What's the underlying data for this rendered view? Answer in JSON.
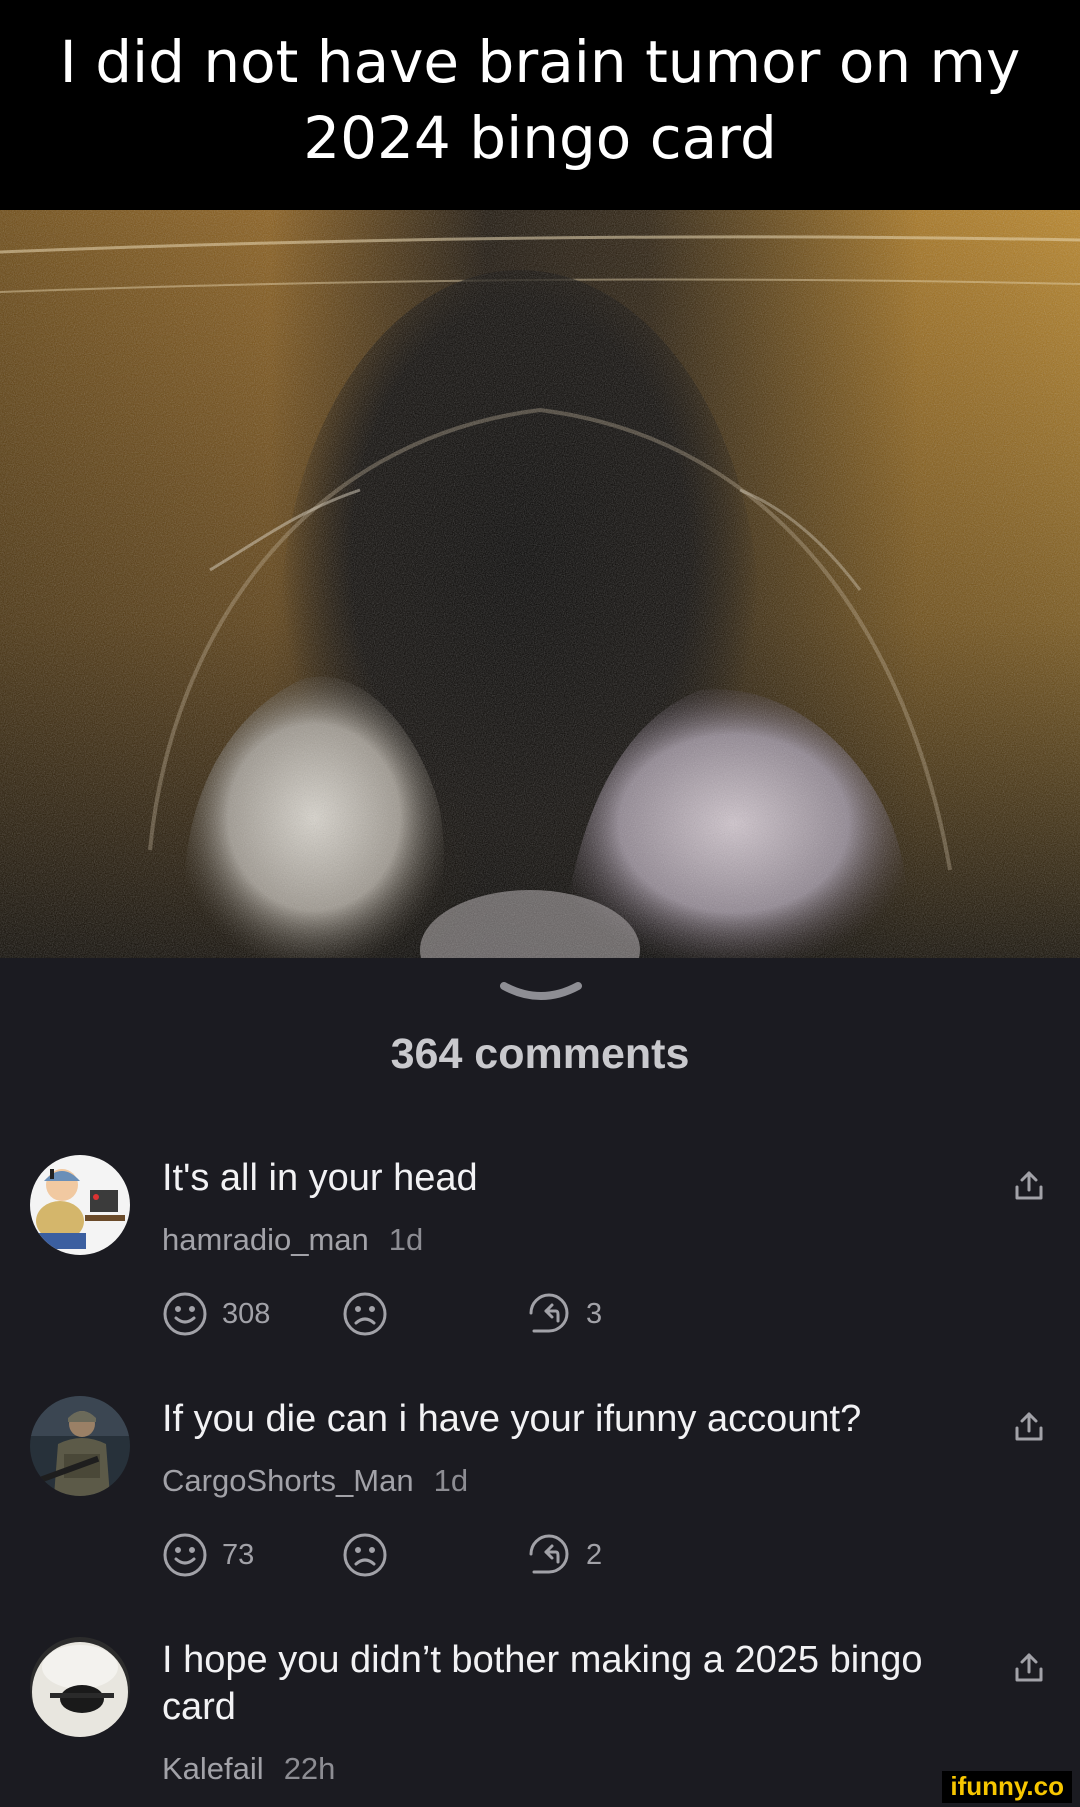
{
  "post": {
    "caption_lines": [
      "I did not have brain tumor on my",
      "2024 bingo card"
    ]
  },
  "comments_header": {
    "count_label": "364 comments"
  },
  "comments": [
    {
      "text": "It's all in your head",
      "user": "hamradio_man",
      "time": "1d",
      "smile_count": "308",
      "reply_count": "3"
    },
    {
      "text": "If you die can i have your ifunny account?",
      "user": "CargoShorts_Man",
      "time": "1d",
      "smile_count": "73",
      "reply_count": "2"
    },
    {
      "text": "I hope you didn’t bother making a 2025 bingo card",
      "user": "Kalefail",
      "time": "22h"
    }
  ],
  "watermark": {
    "text": "ifunny.co"
  },
  "colors": {
    "background": "#1b1b21",
    "caption_bg": "#000000",
    "text_primary": "#f2f2f4",
    "text_secondary": "#a2a2a8",
    "watermark": "#f7c600"
  },
  "icons": {
    "collapse": "chevron-down-icon",
    "smile": "smile-icon",
    "frown": "frown-icon",
    "reply": "reply-icon",
    "share": "share-icon"
  }
}
